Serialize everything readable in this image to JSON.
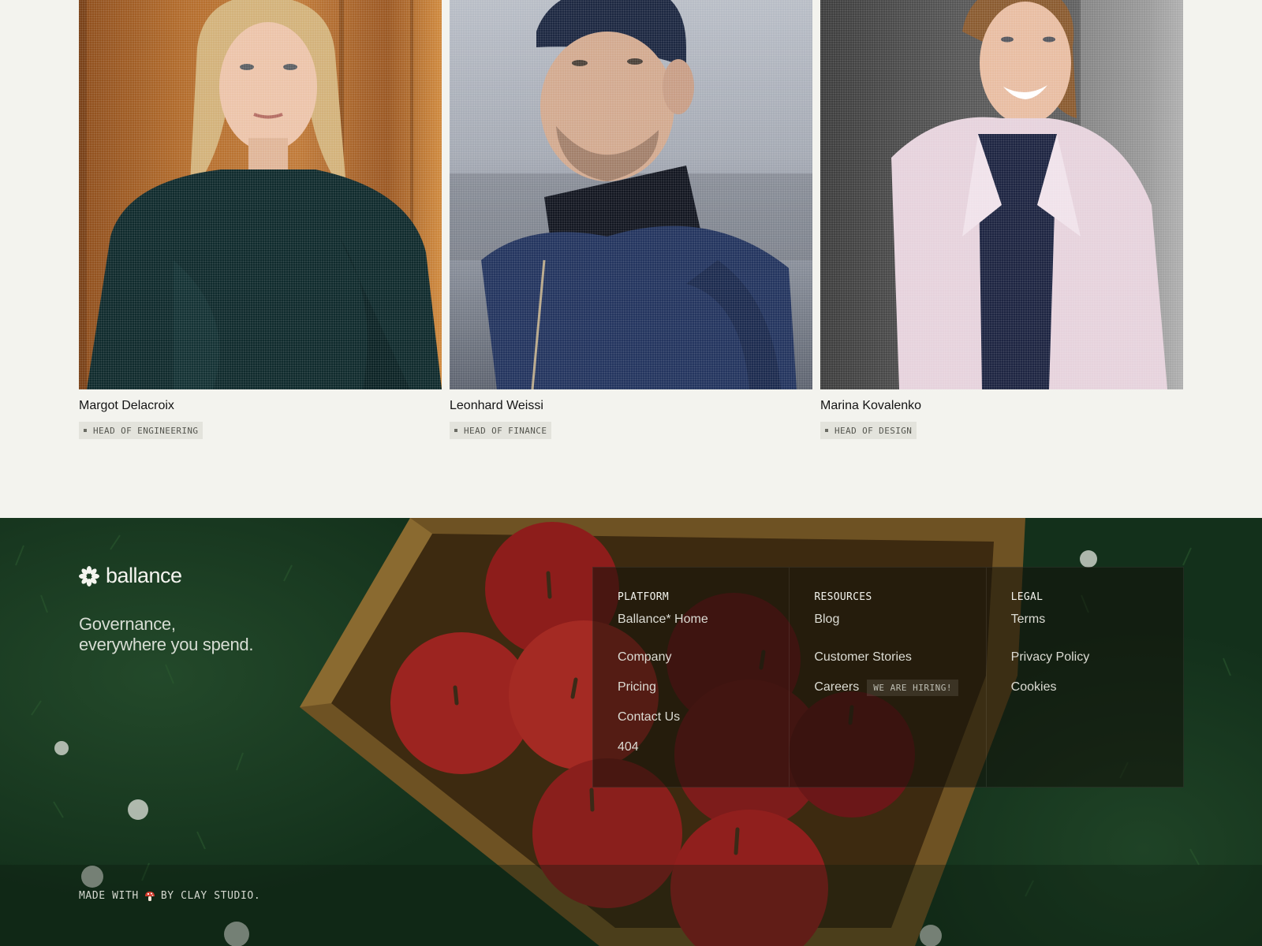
{
  "team": {
    "members": [
      {
        "name": "Margot Delacroix",
        "role": "HEAD OF ENGINEERING"
      },
      {
        "name": "Leonhard Weissi",
        "role": "HEAD OF FINANCE"
      },
      {
        "name": "Marina Kovalenko",
        "role": "HEAD OF DESIGN"
      }
    ]
  },
  "footer": {
    "logo": {
      "icon": "asterisk-flower-icon",
      "text": "ballance"
    },
    "tagline_line1": "Governance,",
    "tagline_line2": "everywhere you spend.",
    "made_with": {
      "prefix": "MADE WITH",
      "icon": "mushroom-icon",
      "suffix": "BY CLAY STUDIO."
    },
    "columns": [
      {
        "title": "PLATFORM",
        "items": [
          "Ballance* Home",
          "Company",
          "Pricing",
          "Contact Us",
          "404"
        ]
      },
      {
        "title": "RESOURCES",
        "items": [
          "Blog",
          "Customer Stories",
          "Careers"
        ],
        "careers_badge": "WE ARE HIRING!"
      },
      {
        "title": "LEGAL",
        "items": [
          "Terms",
          "Privacy Policy",
          "Cookies"
        ]
      }
    ]
  },
  "colors": {
    "page_bg": "#f3f3ee",
    "footer_bg": "#13301b",
    "role_tag_bg": "#e3e3dc"
  }
}
